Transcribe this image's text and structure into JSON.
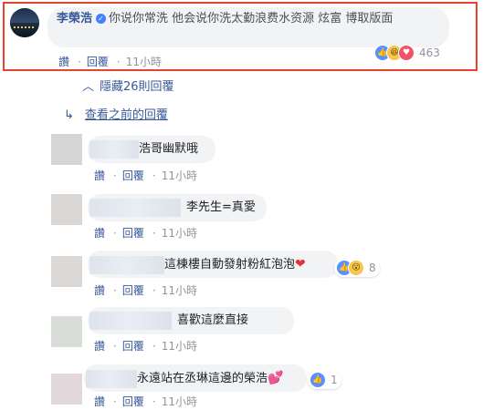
{
  "main_comment": {
    "author": "李榮浩",
    "text": "你说你常洗 他会说你洗太勤浪费水资源 炫富 博取版面",
    "actions": [
      "讚",
      "回覆"
    ],
    "time": "11小時",
    "reaction_count": "463",
    "reactions": [
      "like-icon",
      "haha-icon",
      "love-icon"
    ]
  },
  "thread": {
    "hidden_replies": "隱藏26則回覆",
    "previous_replies": "查看之前的回覆"
  },
  "replies": [
    {
      "text": "浩哥幽默哦",
      "actions": [
        "讚",
        "回覆"
      ],
      "time": "11小時",
      "reaction_count": ""
    },
    {
      "text": "李先生=真愛",
      "actions": [
        "讚",
        "回覆"
      ],
      "time": "11小時",
      "reaction_count": ""
    },
    {
      "text": "這棟樓自動發射粉紅泡泡",
      "emoji": "❤",
      "actions": [
        "讚",
        "回覆"
      ],
      "time": "11小時",
      "reaction_count": "8"
    },
    {
      "text": "喜歡這麼直接",
      "actions": [
        "讚",
        "回覆"
      ],
      "time": "11小時",
      "reaction_count": ""
    },
    {
      "text": "永遠站在丞琳這邊的榮浩",
      "emoji": "💕",
      "actions": [
        "讚",
        "回覆"
      ],
      "time": "11小時",
      "reaction_count": "1"
    }
  ],
  "colors": {
    "highlight_border": "#e8432e",
    "link": "#385898",
    "bubble": "#f2f3f5"
  }
}
